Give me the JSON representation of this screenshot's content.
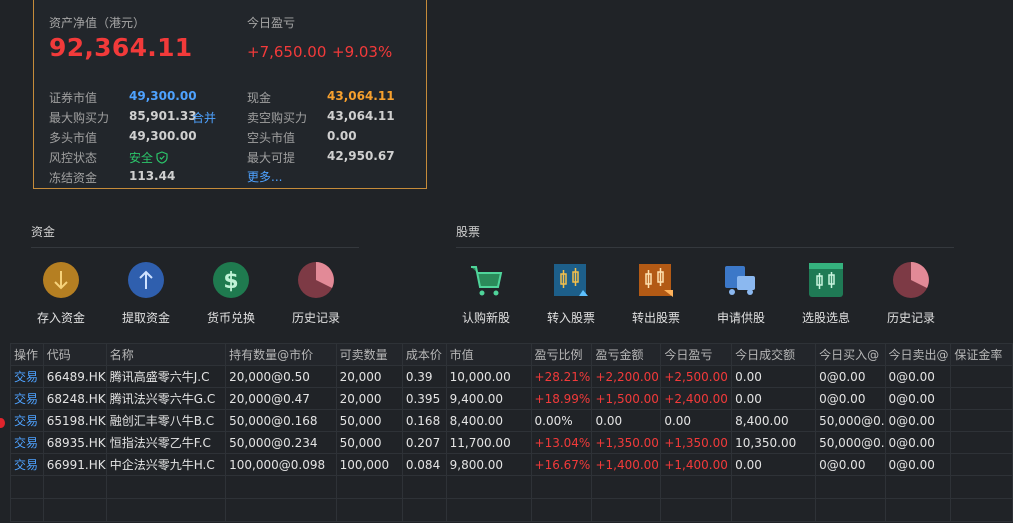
{
  "summary": {
    "net_asset_label": "资产净值（港元）",
    "net_asset_value": "92,364.11",
    "today_pl_label": "今日盈亏",
    "today_pl_amount": "+7,650.00",
    "today_pl_pct": "+9.03%",
    "rows": [
      {
        "k1": "证券市值",
        "v1": "49,300.00",
        "k2": "现金",
        "v2": "43,064.11"
      },
      {
        "k1": "最大购买力",
        "v1": "85,901.33",
        "k2": "卖空购买力",
        "v2": "43,064.11"
      },
      {
        "k1": "多头市值",
        "v1": "49,300.00",
        "k2": "空头市值",
        "v2": "0.00"
      },
      {
        "k1": "风控状态",
        "v1": "安全",
        "k2": "最大可提",
        "v2": "42,950.67"
      },
      {
        "k1": "冻结资金",
        "v1": "113.44",
        "k2": "",
        "v2": ""
      }
    ],
    "merge_link": "合并",
    "more_link": "更多...",
    "colors": {
      "positive": "#f23a3a",
      "blue": "#4ea2ff",
      "orange": "#f7a02d",
      "safe": "#2bc46a"
    }
  },
  "funds": {
    "title": "资金",
    "tiles": [
      {
        "label": "存入资金",
        "icon": "deposit-icon"
      },
      {
        "label": "提取资金",
        "icon": "withdraw-icon"
      },
      {
        "label": "货币兑换",
        "icon": "currency-exchange-icon"
      },
      {
        "label": "历史记录",
        "icon": "history-icon"
      }
    ]
  },
  "stocks": {
    "title": "股票",
    "tiles": [
      {
        "label": "认购新股",
        "icon": "ipo-cart-icon"
      },
      {
        "label": "转入股票",
        "icon": "transfer-in-icon"
      },
      {
        "label": "转出股票",
        "icon": "transfer-out-icon"
      },
      {
        "label": "申请供股",
        "icon": "rights-issue-icon"
      },
      {
        "label": "选股选息",
        "icon": "scrip-dividend-icon"
      },
      {
        "label": "历史记录",
        "icon": "history-icon"
      }
    ]
  },
  "holdings": {
    "headers": [
      "操作",
      "代码",
      "名称",
      "持有数量@市价",
      "可卖数量",
      "成本价",
      "市值",
      "盈亏比例",
      "盈亏金额",
      "今日盈亏",
      "今日成交额",
      "今日买入@",
      "今日卖出@",
      "保证金率"
    ],
    "rows": [
      [
        "交易",
        "66489.HK",
        "腾讯高盛零六牛J.C",
        "20,000@0.50",
        "20,000",
        "0.39",
        "10,000.00",
        "+28.21%",
        "+2,200.00",
        "+2,500.00",
        "0.00",
        "0@0.00",
        "0@0.00",
        ""
      ],
      [
        "交易",
        "68248.HK",
        "腾讯法兴零六牛G.C",
        "20,000@0.47",
        "20,000",
        "0.395",
        "9,400.00",
        "+18.99%",
        "+1,500.00",
        "+2,400.00",
        "0.00",
        "0@0.00",
        "0@0.00",
        ""
      ],
      [
        "交易",
        "65198.HK",
        "融创汇丰零八牛B.C",
        "50,000@0.168",
        "50,000",
        "0.168",
        "8,400.00",
        "0.00%",
        "0.00",
        "0.00",
        "8,400.00",
        "50,000@0.",
        "0@0.00",
        ""
      ],
      [
        "交易",
        "68935.HK",
        "恒指法兴零乙牛F.C",
        "50,000@0.234",
        "50,000",
        "0.207",
        "11,700.00",
        "+13.04%",
        "+1,350.00",
        "+1,350.00",
        "10,350.00",
        "50,000@0.",
        "0@0.00",
        ""
      ],
      [
        "交易",
        "66991.HK",
        "中企法兴零九牛H.C",
        "100,000@0.098",
        "100,000",
        "0.084",
        "9,800.00",
        "+16.67%",
        "+1,400.00",
        "+1,400.00",
        "0.00",
        "0@0.00",
        "0@0.00",
        ""
      ]
    ]
  }
}
